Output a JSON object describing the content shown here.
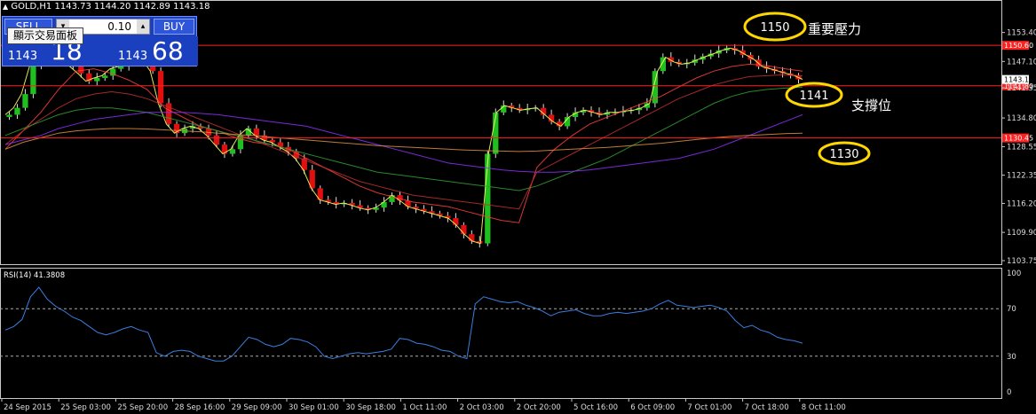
{
  "header": {
    "symbol_title": "GOLD,H1",
    "ohlc": "1143.73 1144.20 1142.89 1143.18"
  },
  "trade_panel": {
    "sell_label": "SELL",
    "buy_label": "BUY",
    "lot_value": "0.10",
    "sell_price_small": "1143",
    "sell_price_big": "18",
    "buy_price_small": "1143",
    "buy_price_big": "68",
    "tooltip": "顯示交易面板",
    "panel_color": "#1a3fbf"
  },
  "annotations": {
    "resistance_value": "1150",
    "resistance_text": "重要壓力",
    "support_value": "1141",
    "support_text": "支撐位",
    "support2_value": "1130",
    "circle_color": "#ffd700"
  },
  "price_axis": {
    "ticks": [
      "1153.40",
      "1147.10",
      "1141.35",
      "1134.80",
      "1128.55",
      "1122.35",
      "1116.20",
      "1109.90",
      "1103.75"
    ],
    "level_labels": [
      "1150.60",
      "1141.80",
      "1130.45"
    ],
    "current_price_label": "1143.18"
  },
  "time_axis": {
    "labels": [
      "24 Sep 2015",
      "25 Sep 03:00",
      "25 Sep 20:00",
      "28 Sep 16:00",
      "29 Sep 09:00",
      "30 Sep 01:00",
      "30 Sep 18:00",
      "1 Oct 11:00",
      "2 Oct 03:00",
      "2 Oct 20:00",
      "5 Oct 16:00",
      "6 Oct 09:00",
      "7 Oct 01:00",
      "7 Oct 18:00",
      "8 Oct 11:00"
    ]
  },
  "rsi": {
    "label": "RSI(14) 41.3808",
    "ticks": [
      "100",
      "70",
      "30",
      "0"
    ],
    "levels": [
      70,
      30
    ]
  },
  "colors": {
    "bull": "#1fbf1f",
    "bear": "#e01010",
    "hline": "#ff2020",
    "ma_fast": "#ffff66",
    "ma_red1": "#ff4040",
    "ma_red2": "#c03030",
    "ma_green": "#30a030",
    "ma_purple": "#9030ff",
    "ma_orange": "#e09040",
    "rsi_line": "#3a7fe0"
  },
  "chart_data": [
    {
      "type": "line",
      "title": "GOLD,H1",
      "ylim": [
        1103.75,
        1157
      ],
      "hlines": [
        1150.6,
        1141.8,
        1130.45
      ],
      "series": [
        {
          "values": [
            1135.5,
            1137.0,
            1140.0,
            1146.0,
            1152.0,
            1149.5,
            1148.5,
            1148.0,
            1146.0,
            1144.5,
            1142.8,
            1143.5,
            1144.0,
            1145.5,
            1146.0,
            1147.0,
            1148.0,
            1147.5,
            1145.0,
            1138.0,
            1133.5,
            1131.5,
            1132.5,
            1133.0,
            1132.5,
            1131.0,
            1129.0,
            1127.0,
            1128.0,
            1131.0,
            1132.5,
            1131.0,
            1130.0,
            1129.5,
            1128.5,
            1127.5,
            1126.0,
            1123.5,
            1119.5,
            1117.0,
            1116.5,
            1116.0,
            1116.3,
            1115.8,
            1115.2,
            1114.8,
            1115.3,
            1116.5,
            1118.0,
            1116.8,
            1115.5,
            1115.0,
            1114.5,
            1114.0,
            1113.5,
            1113.0,
            1111.5,
            1109.5,
            1108.0,
            1107.5,
            1127.0,
            1136.0,
            1137.5,
            1137.0,
            1136.5,
            1136.8,
            1137.0,
            1135.5,
            1134.0,
            1133.0,
            1135.0,
            1136.0,
            1136.5,
            1136.0,
            1135.5,
            1136.0,
            1136.0,
            1136.3,
            1136.5,
            1137.0,
            1138.0,
            1145.0,
            1148.0,
            1147.0,
            1146.5,
            1146.8,
            1147.5,
            1148.2,
            1148.8,
            1149.5,
            1150.0,
            1149.5,
            1148.5,
            1147.5,
            1146.0,
            1145.5,
            1145.0,
            1144.5,
            1144.0,
            1143.2
          ]
        },
        {
          "values": [
            1128,
            1132,
            1136,
            1141,
            1145,
            1145.5,
            1144.5,
            1143,
            1141,
            1137,
            1135,
            1133,
            1132,
            1130.5,
            1129.5,
            1129,
            1128,
            1126,
            1124,
            1122,
            1120,
            1118.5,
            1117.5,
            1116.5,
            1116,
            1115.5,
            1114.5,
            1113.5,
            1112.5,
            1112,
            1124,
            1128,
            1131,
            1133.5,
            1135,
            1136.5,
            1138,
            1139.5,
            1141.5,
            1143.5,
            1145,
            1146,
            1146.5,
            1146.2,
            1145.5,
            1145
          ]
        },
        {
          "values": [
            1129,
            1132,
            1134.5,
            1137,
            1139,
            1140,
            1140.5,
            1140,
            1139,
            1137.5,
            1136,
            1134.5,
            1133,
            1131.5,
            1130,
            1128.5,
            1127,
            1125.5,
            1124,
            1122.5,
            1121,
            1120,
            1119,
            1118,
            1117.5,
            1117,
            1116.5,
            1116,
            1115.5,
            1115,
            1123,
            1125,
            1127,
            1129,
            1131,
            1133,
            1135,
            1137,
            1139,
            1140.5,
            1142,
            1143,
            1143.8,
            1144,
            1144.2,
            1144
          ]
        },
        {
          "values": [
            1131,
            1132.5,
            1134,
            1135.5,
            1136.5,
            1137,
            1137,
            1136.5,
            1136,
            1135,
            1134,
            1133,
            1132,
            1131,
            1130,
            1129,
            1128,
            1127,
            1126,
            1125,
            1124,
            1123,
            1122.5,
            1122,
            1121.5,
            1121,
            1120.5,
            1120,
            1119.5,
            1119,
            1120,
            1121.5,
            1123,
            1124.5,
            1126,
            1128,
            1130,
            1132,
            1134,
            1136,
            1138,
            1139.5,
            1140.5,
            1141,
            1141.3,
            1141.5
          ]
        },
        {
          "values": [
            1129,
            1130,
            1131,
            1132.5,
            1133.5,
            1134.5,
            1135,
            1135.5,
            1136,
            1136,
            1136,
            1135.8,
            1135.5,
            1135,
            1134.5,
            1134,
            1133.5,
            1133,
            1132,
            1131,
            1130,
            1129,
            1128,
            1127,
            1126,
            1125,
            1124.5,
            1124,
            1123.5,
            1123.2,
            1123,
            1123,
            1123.2,
            1123.5,
            1124,
            1124.5,
            1125,
            1125.5,
            1126,
            1127,
            1128,
            1129.5,
            1131,
            1132.5,
            1134,
            1135.5
          ]
        },
        {
          "values": [
            1128,
            1129.5,
            1130.5,
            1131.5,
            1132,
            1132.3,
            1132.5,
            1132.5,
            1132.4,
            1132.2,
            1132,
            1131.8,
            1131.5,
            1131.2,
            1131,
            1130.6,
            1130.3,
            1130,
            1129.7,
            1129.4,
            1129.1,
            1128.8,
            1128.6,
            1128.4,
            1128.2,
            1128,
            1127.8,
            1127.7,
            1127.6,
            1127.5,
            1127.6,
            1127.8,
            1128,
            1128.2,
            1128.4,
            1128.7,
            1129,
            1129.3,
            1129.7,
            1130.1,
            1130.5,
            1130.8,
            1131,
            1131.2,
            1131.4,
            1131.5
          ]
        }
      ]
    },
    {
      "type": "line",
      "title": "RSI(14) 41.3808",
      "ylim": [
        0,
        100
      ],
      "series": [
        {
          "values": [
            52,
            55,
            61,
            80,
            88,
            78,
            72,
            68,
            63,
            60,
            55,
            50,
            48,
            50,
            53,
            55,
            52,
            50,
            33,
            30,
            34,
            35,
            34,
            30,
            28,
            26,
            26,
            30,
            38,
            46,
            44,
            40,
            38,
            40,
            45,
            44,
            42,
            38,
            30,
            28,
            30,
            32,
            33,
            32,
            33,
            34,
            36,
            45,
            44,
            41,
            40,
            38,
            35,
            34,
            30,
            28,
            74,
            80,
            78,
            76,
            75,
            76,
            73,
            71,
            68,
            64,
            67,
            68,
            69,
            66,
            64,
            64,
            66,
            67,
            66,
            67,
            68,
            70,
            74,
            77,
            73,
            72,
            71,
            72,
            73,
            71,
            68,
            60,
            54,
            56,
            52,
            50,
            46,
            44,
            43,
            41
          ]
        }
      ]
    }
  ]
}
